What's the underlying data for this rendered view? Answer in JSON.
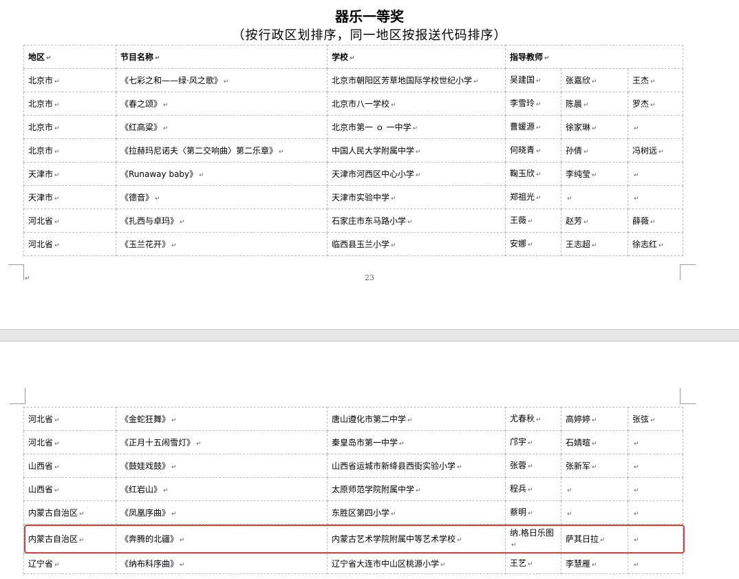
{
  "title": "器乐一等奖",
  "subtitle": "（按行政区划排序，同一地区按报送代码排序）",
  "headers": {
    "region": "地区",
    "program": "节目名称",
    "school": "学校",
    "teachers": "指导教师"
  },
  "mark": "↵",
  "page_number": "23",
  "rows_page1": [
    {
      "region": "北京市",
      "program": "《七彩之和——绿·风之歌》",
      "school": "北京市朝阳区芳草地国际学校世纪小学",
      "t1": "吴建国",
      "t2": "张嘉欣",
      "t3": "王杰"
    },
    {
      "region": "北京市",
      "program": "《春之颂》",
      "school": "北京市八一学校",
      "t1": "李雪玲",
      "t2": "陈晨",
      "t3": "罗杰"
    },
    {
      "region": "北京市",
      "program": "《红高粱》",
      "school": "北京市第一 ｏ 一中学",
      "t1": "曹媛源",
      "t2": "徐家琳",
      "t3": ""
    },
    {
      "region": "北京市",
      "program": "《拉赫玛尼诺夫〈第二交响曲〉第二乐章》",
      "school": "中国人民大学附属中学",
      "t1": "何晓青",
      "t2": "孙倩",
      "t3": "冯树远"
    },
    {
      "region": "天津市",
      "program": "《Runaway baby》",
      "school": "天津市河西区中心小学",
      "t1": "鞠玉欣",
      "t2": "李纯莹",
      "t3": ""
    },
    {
      "region": "天津市",
      "program": "《德音》",
      "school": "天津市实验中学",
      "t1": "郑祖光",
      "t2": "",
      "t3": ""
    },
    {
      "region": "河北省",
      "program": "《扎西与卓玛》",
      "school": "石家庄市东马路小学",
      "t1": "王薇",
      "t2": "赵芳",
      "t3": "薛薇"
    },
    {
      "region": "河北省",
      "program": "《玉兰花开》",
      "school": "临西县玉兰小学",
      "t1": "安娜",
      "t2": "王志超",
      "t3": "徐志红"
    }
  ],
  "rows_page2": [
    {
      "region": "河北省",
      "program": "《金蛇狂舞》",
      "school": "唐山遵化市第二中学",
      "t1": "尤春秋",
      "t2": "高婷婷",
      "t3": "张弦"
    },
    {
      "region": "河北省",
      "program": "《正月十五闹雪灯》",
      "school": "秦皇岛市第一中学",
      "t1": "邝宇",
      "t2": "石婧暄",
      "t3": ""
    },
    {
      "region": "山西省",
      "program": "《鼓娃戏鼓》",
      "school": "山西省运城市新绛县西街实验小学",
      "t1": "张蓉",
      "t2": "张新军",
      "t3": ""
    },
    {
      "region": "山西省",
      "program": "《红岩山》",
      "school": "太原师范学院附属中学",
      "t1": "程兵",
      "t2": "",
      "t3": ""
    },
    {
      "region": "内蒙古自治区",
      "program": "《凤凰序曲》",
      "school": "东胜区第四小学",
      "t1": "蔡明",
      "t2": "",
      "t3": ""
    },
    {
      "region": "内蒙古自治区",
      "program": "《奔腾的北疆》",
      "school": "内蒙古艺术学院附属中等艺术学校",
      "t1": "纳.格日乐图",
      "t2": "萨其日拉",
      "t3": ""
    },
    {
      "region": "辽宁省",
      "program": "《纳布科序曲》",
      "school": "辽宁省大连市中山区桃源小学",
      "t1": "王艺",
      "t2": "李慧雁",
      "t3": ""
    }
  ]
}
